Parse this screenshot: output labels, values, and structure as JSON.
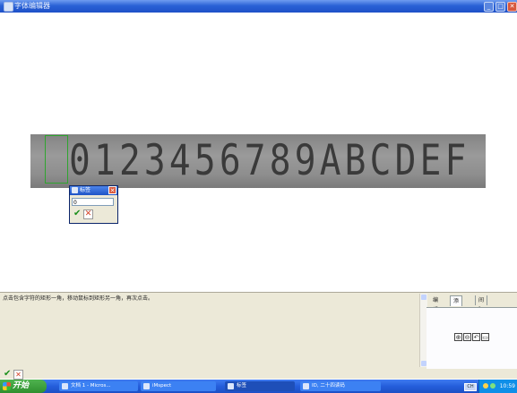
{
  "window": {
    "title": "字体编辑器",
    "min_symbol": "_",
    "max_symbol": "□",
    "close_symbol": "✕"
  },
  "canvas": {
    "image_text": "0123456789ABCDEF"
  },
  "label_dialog": {
    "title": "标签",
    "value": "0",
    "ok_symbol": "✔",
    "cancel_symbol": "✕"
  },
  "hint_panel": {
    "text": "点击包含字符的矩形一角，移动鼠标到矩形另一角，再次点击。"
  },
  "tabs": [
    {
      "label": "编辑"
    },
    {
      "label": "添加"
    },
    {
      "label": "间隔"
    }
  ],
  "tools": [
    {
      "icon": "zoom-in-icon",
      "glyph": "⊕"
    },
    {
      "icon": "zoom-out-icon",
      "glyph": "⊖"
    },
    {
      "icon": "undo-icon",
      "glyph": "↶"
    },
    {
      "icon": "open-folder-icon",
      "glyph": "▭"
    }
  ],
  "footer": {
    "ok_symbol": "✔",
    "cancel_symbol": "✕"
  },
  "taskbar": {
    "start_label": "开始",
    "tasks": [
      {
        "label": "文档 1 - Micros..."
      },
      {
        "label": "iMspect"
      },
      {
        "label": "标签"
      },
      {
        "label": "ID, 二十四读码"
      }
    ],
    "lang": "CH",
    "clock": "10:59"
  },
  "colors": {
    "title_bar": "#245edb",
    "selection_box": "#2fa52f",
    "ok_green": "#1b8f1b",
    "cancel_red": "#d43b1f"
  }
}
